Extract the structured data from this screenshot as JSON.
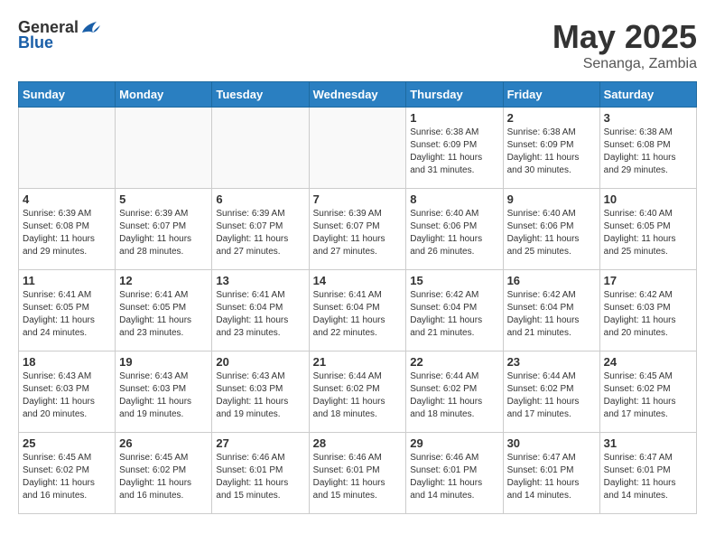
{
  "header": {
    "logo_general": "General",
    "logo_blue": "Blue",
    "month": "May 2025",
    "location": "Senanga, Zambia"
  },
  "weekdays": [
    "Sunday",
    "Monday",
    "Tuesday",
    "Wednesday",
    "Thursday",
    "Friday",
    "Saturday"
  ],
  "weeks": [
    [
      {
        "day": "",
        "sunrise": "",
        "sunset": "",
        "daylight": ""
      },
      {
        "day": "",
        "sunrise": "",
        "sunset": "",
        "daylight": ""
      },
      {
        "day": "",
        "sunrise": "",
        "sunset": "",
        "daylight": ""
      },
      {
        "day": "",
        "sunrise": "",
        "sunset": "",
        "daylight": ""
      },
      {
        "day": "1",
        "sunrise": "Sunrise: 6:38 AM",
        "sunset": "Sunset: 6:09 PM",
        "daylight": "Daylight: 11 hours and 31 minutes."
      },
      {
        "day": "2",
        "sunrise": "Sunrise: 6:38 AM",
        "sunset": "Sunset: 6:09 PM",
        "daylight": "Daylight: 11 hours and 30 minutes."
      },
      {
        "day": "3",
        "sunrise": "Sunrise: 6:38 AM",
        "sunset": "Sunset: 6:08 PM",
        "daylight": "Daylight: 11 hours and 29 minutes."
      }
    ],
    [
      {
        "day": "4",
        "sunrise": "Sunrise: 6:39 AM",
        "sunset": "Sunset: 6:08 PM",
        "daylight": "Daylight: 11 hours and 29 minutes."
      },
      {
        "day": "5",
        "sunrise": "Sunrise: 6:39 AM",
        "sunset": "Sunset: 6:07 PM",
        "daylight": "Daylight: 11 hours and 28 minutes."
      },
      {
        "day": "6",
        "sunrise": "Sunrise: 6:39 AM",
        "sunset": "Sunset: 6:07 PM",
        "daylight": "Daylight: 11 hours and 27 minutes."
      },
      {
        "day": "7",
        "sunrise": "Sunrise: 6:39 AM",
        "sunset": "Sunset: 6:07 PM",
        "daylight": "Daylight: 11 hours and 27 minutes."
      },
      {
        "day": "8",
        "sunrise": "Sunrise: 6:40 AM",
        "sunset": "Sunset: 6:06 PM",
        "daylight": "Daylight: 11 hours and 26 minutes."
      },
      {
        "day": "9",
        "sunrise": "Sunrise: 6:40 AM",
        "sunset": "Sunset: 6:06 PM",
        "daylight": "Daylight: 11 hours and 25 minutes."
      },
      {
        "day": "10",
        "sunrise": "Sunrise: 6:40 AM",
        "sunset": "Sunset: 6:05 PM",
        "daylight": "Daylight: 11 hours and 25 minutes."
      }
    ],
    [
      {
        "day": "11",
        "sunrise": "Sunrise: 6:41 AM",
        "sunset": "Sunset: 6:05 PM",
        "daylight": "Daylight: 11 hours and 24 minutes."
      },
      {
        "day": "12",
        "sunrise": "Sunrise: 6:41 AM",
        "sunset": "Sunset: 6:05 PM",
        "daylight": "Daylight: 11 hours and 23 minutes."
      },
      {
        "day": "13",
        "sunrise": "Sunrise: 6:41 AM",
        "sunset": "Sunset: 6:04 PM",
        "daylight": "Daylight: 11 hours and 23 minutes."
      },
      {
        "day": "14",
        "sunrise": "Sunrise: 6:41 AM",
        "sunset": "Sunset: 6:04 PM",
        "daylight": "Daylight: 11 hours and 22 minutes."
      },
      {
        "day": "15",
        "sunrise": "Sunrise: 6:42 AM",
        "sunset": "Sunset: 6:04 PM",
        "daylight": "Daylight: 11 hours and 21 minutes."
      },
      {
        "day": "16",
        "sunrise": "Sunrise: 6:42 AM",
        "sunset": "Sunset: 6:04 PM",
        "daylight": "Daylight: 11 hours and 21 minutes."
      },
      {
        "day": "17",
        "sunrise": "Sunrise: 6:42 AM",
        "sunset": "Sunset: 6:03 PM",
        "daylight": "Daylight: 11 hours and 20 minutes."
      }
    ],
    [
      {
        "day": "18",
        "sunrise": "Sunrise: 6:43 AM",
        "sunset": "Sunset: 6:03 PM",
        "daylight": "Daylight: 11 hours and 20 minutes."
      },
      {
        "day": "19",
        "sunrise": "Sunrise: 6:43 AM",
        "sunset": "Sunset: 6:03 PM",
        "daylight": "Daylight: 11 hours and 19 minutes."
      },
      {
        "day": "20",
        "sunrise": "Sunrise: 6:43 AM",
        "sunset": "Sunset: 6:03 PM",
        "daylight": "Daylight: 11 hours and 19 minutes."
      },
      {
        "day": "21",
        "sunrise": "Sunrise: 6:44 AM",
        "sunset": "Sunset: 6:02 PM",
        "daylight": "Daylight: 11 hours and 18 minutes."
      },
      {
        "day": "22",
        "sunrise": "Sunrise: 6:44 AM",
        "sunset": "Sunset: 6:02 PM",
        "daylight": "Daylight: 11 hours and 18 minutes."
      },
      {
        "day": "23",
        "sunrise": "Sunrise: 6:44 AM",
        "sunset": "Sunset: 6:02 PM",
        "daylight": "Daylight: 11 hours and 17 minutes."
      },
      {
        "day": "24",
        "sunrise": "Sunrise: 6:45 AM",
        "sunset": "Sunset: 6:02 PM",
        "daylight": "Daylight: 11 hours and 17 minutes."
      }
    ],
    [
      {
        "day": "25",
        "sunrise": "Sunrise: 6:45 AM",
        "sunset": "Sunset: 6:02 PM",
        "daylight": "Daylight: 11 hours and 16 minutes."
      },
      {
        "day": "26",
        "sunrise": "Sunrise: 6:45 AM",
        "sunset": "Sunset: 6:02 PM",
        "daylight": "Daylight: 11 hours and 16 minutes."
      },
      {
        "day": "27",
        "sunrise": "Sunrise: 6:46 AM",
        "sunset": "Sunset: 6:01 PM",
        "daylight": "Daylight: 11 hours and 15 minutes."
      },
      {
        "day": "28",
        "sunrise": "Sunrise: 6:46 AM",
        "sunset": "Sunset: 6:01 PM",
        "daylight": "Daylight: 11 hours and 15 minutes."
      },
      {
        "day": "29",
        "sunrise": "Sunrise: 6:46 AM",
        "sunset": "Sunset: 6:01 PM",
        "daylight": "Daylight: 11 hours and 14 minutes."
      },
      {
        "day": "30",
        "sunrise": "Sunrise: 6:47 AM",
        "sunset": "Sunset: 6:01 PM",
        "daylight": "Daylight: 11 hours and 14 minutes."
      },
      {
        "day": "31",
        "sunrise": "Sunrise: 6:47 AM",
        "sunset": "Sunset: 6:01 PM",
        "daylight": "Daylight: 11 hours and 14 minutes."
      }
    ]
  ]
}
